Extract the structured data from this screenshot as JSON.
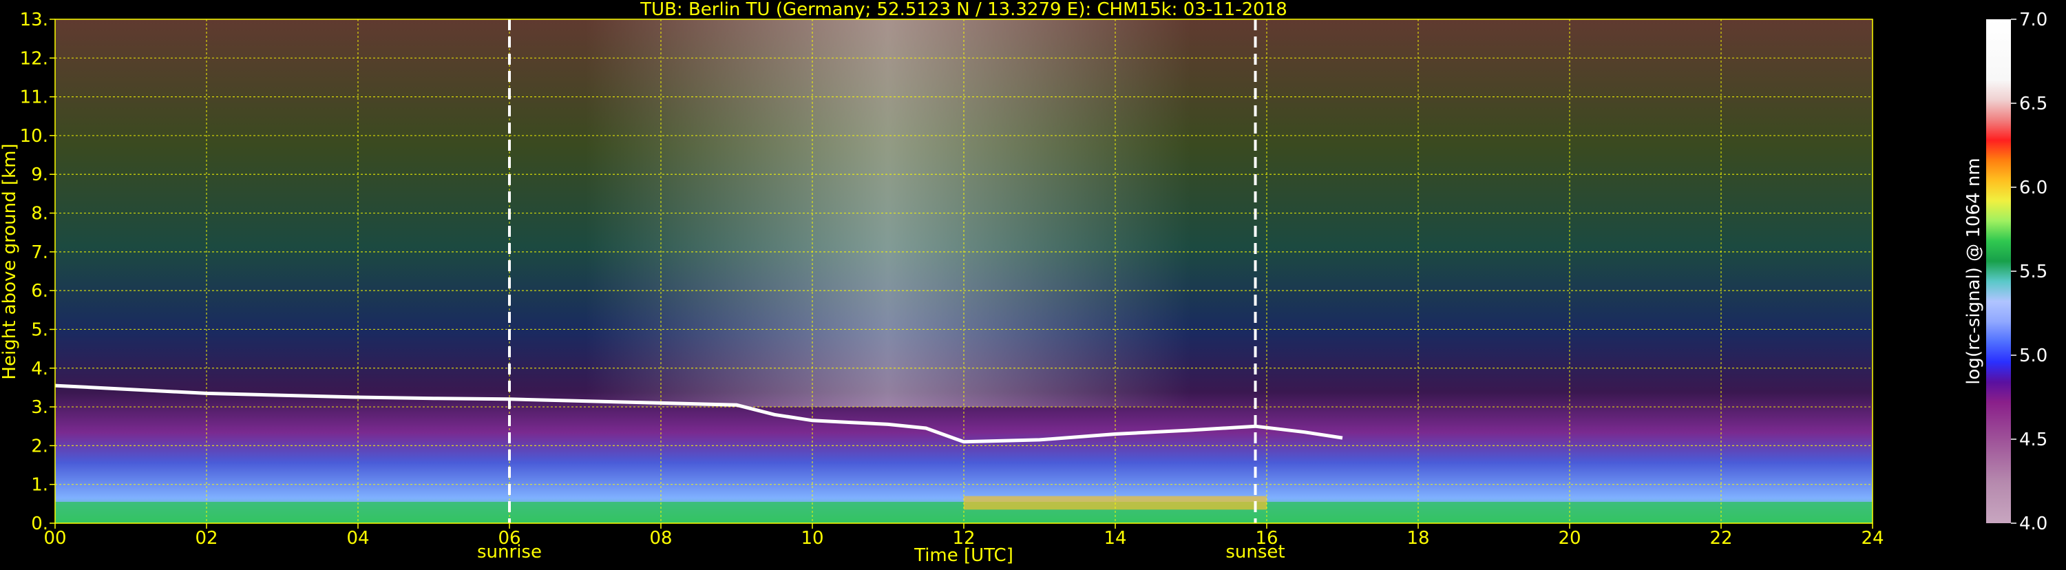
{
  "chart_data": {
    "type": "heatmap",
    "title": "TUB: Berlin TU (Germany; 52.5123 N / 13.3279 E):    CHM15k: 03-11-2018",
    "xlabel": "Time [UTC]",
    "ylabel": "Height above ground [km]",
    "colorbar_label": "log(rc-signal) @ 1064 nm",
    "xlim": [
      0,
      24
    ],
    "ylim": [
      0,
      13
    ],
    "x_ticks": [
      "00",
      "02",
      "04",
      "06",
      "08",
      "10",
      "12",
      "14",
      "16",
      "18",
      "20",
      "22",
      "24"
    ],
    "y_ticks": [
      "0.",
      "1.",
      "2.",
      "3.",
      "4.",
      "5.",
      "6.",
      "7.",
      "8.",
      "9.",
      "10.",
      "11.",
      "12.",
      "13."
    ],
    "colorbar_range": [
      4.0,
      7.0
    ],
    "colorbar_ticks": [
      "4.0",
      "4.5",
      "5.0",
      "5.5",
      "6.0",
      "6.5",
      "7.0"
    ],
    "grid": true,
    "annotations": [
      {
        "text": "sunrise",
        "x": 6.0
      },
      {
        "text": "sunset",
        "x": 15.85
      }
    ],
    "boundary_layer_top_km": [
      [
        0,
        3.55
      ],
      [
        1,
        3.45
      ],
      [
        2,
        3.35
      ],
      [
        3,
        3.3
      ],
      [
        4,
        3.25
      ],
      [
        5,
        3.22
      ],
      [
        6,
        3.2
      ],
      [
        7,
        3.15
      ],
      [
        8,
        3.1
      ],
      [
        9,
        3.05
      ],
      [
        9.5,
        2.8
      ],
      [
        10,
        2.65
      ],
      [
        10.5,
        2.6
      ],
      [
        11,
        2.55
      ],
      [
        11.5,
        2.45
      ],
      [
        12,
        2.1
      ],
      [
        13,
        2.15
      ],
      [
        14,
        2.3
      ],
      [
        15,
        2.4
      ],
      [
        15.85,
        2.5
      ],
      [
        16.5,
        2.35
      ],
      [
        17,
        2.2
      ]
    ],
    "colors": {
      "axis": "#ffff00",
      "grid": "#ffff00",
      "background": "#000000",
      "dashed_lines": "#ffffff"
    }
  }
}
